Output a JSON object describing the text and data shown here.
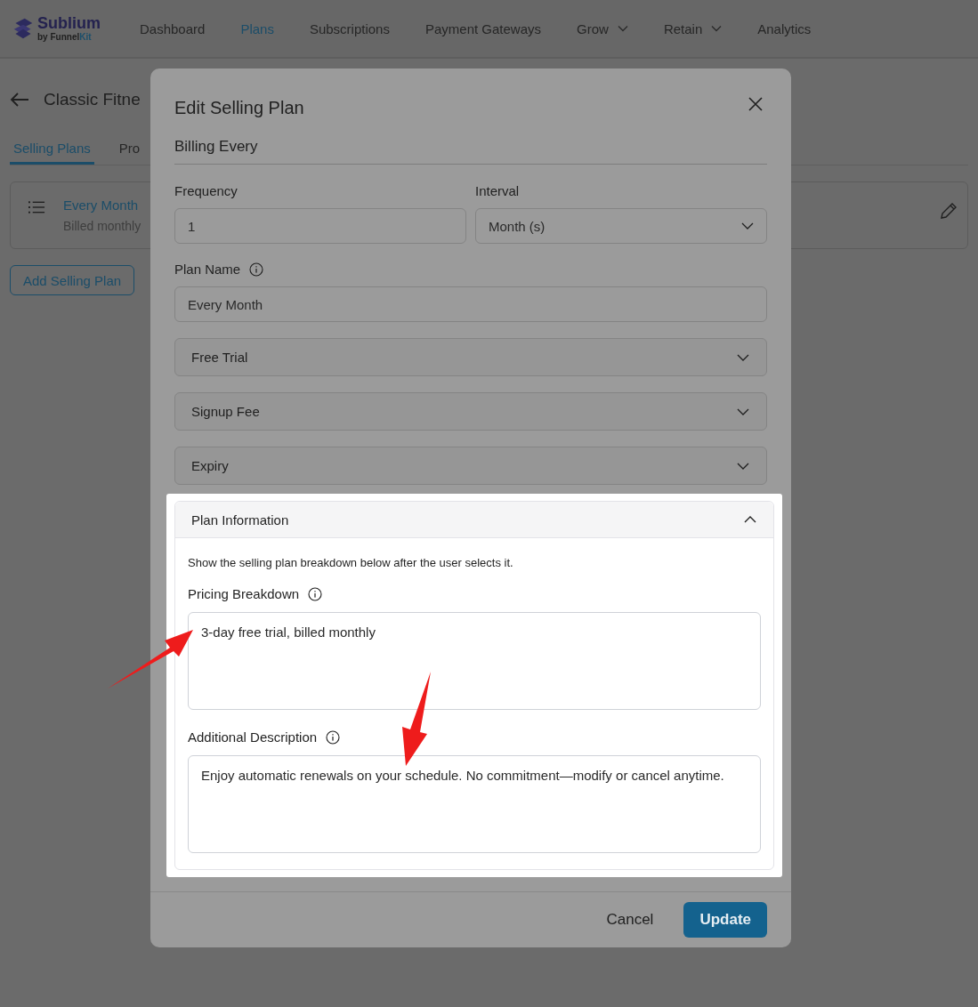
{
  "brand": {
    "name": "Sublium",
    "byline_prefix": "by Funnel",
    "byline_suffix": "Kit"
  },
  "nav": [
    {
      "label": "Dashboard",
      "selected": false,
      "dropdown": false
    },
    {
      "label": "Plans",
      "selected": true,
      "dropdown": false
    },
    {
      "label": "Subscriptions",
      "selected": false,
      "dropdown": false
    },
    {
      "label": "Payment Gateways",
      "selected": false,
      "dropdown": false
    },
    {
      "label": "Grow",
      "selected": false,
      "dropdown": true
    },
    {
      "label": "Retain",
      "selected": false,
      "dropdown": true
    },
    {
      "label": "Analytics",
      "selected": false,
      "dropdown": false
    }
  ],
  "page": {
    "title": "Classic Fitne",
    "tabs": [
      {
        "label": "Selling Plans",
        "selected": true
      },
      {
        "label": "Pro",
        "selected": false
      }
    ],
    "plan_card": {
      "name": "Every Month",
      "subtitle": "Billed monthly"
    },
    "add_button": "Add Selling Plan"
  },
  "modal": {
    "title": "Edit Selling Plan",
    "section": "Billing Every",
    "frequency": {
      "label": "Frequency",
      "value": "1"
    },
    "interval": {
      "label": "Interval",
      "value": "Month (s)"
    },
    "plan_name": {
      "label": "Plan Name",
      "value": "Every Month"
    },
    "accordions": [
      {
        "title": "Free Trial",
        "expanded": false
      },
      {
        "title": "Signup Fee",
        "expanded": false
      },
      {
        "title": "Expiry",
        "expanded": false
      }
    ],
    "plan_information": {
      "title": "Plan Information",
      "expanded": true,
      "highlighted": true,
      "description": "Show the selling plan breakdown below after the user selects it.",
      "pricing_label": "Pricing Breakdown",
      "pricing_value": "3-day free trial, billed monthly",
      "additional_label": "Additional Description",
      "additional_value": "Enjoy automatic renewals on your schedule. No commitment—modify or cancel anytime."
    },
    "cancel": "Cancel",
    "update": "Update"
  }
}
